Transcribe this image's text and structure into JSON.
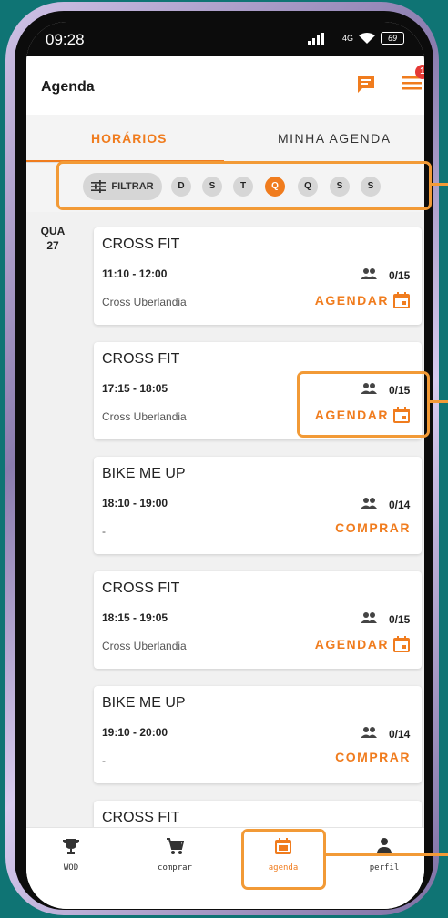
{
  "status": {
    "time": "09:28",
    "network": "4G",
    "battery": "69"
  },
  "header": {
    "title": "Agenda",
    "notification_count": "1"
  },
  "tabs": [
    {
      "label": "HORÁRIOS",
      "active": true
    },
    {
      "label": "MINHA AGENDA",
      "active": false
    }
  ],
  "filter": {
    "label": "FILTRAR",
    "days": [
      "D",
      "S",
      "T",
      "Q",
      "Q",
      "S",
      "S"
    ],
    "active_day_index": 3
  },
  "date": {
    "weekday": "QUA",
    "day": "27"
  },
  "classes": [
    {
      "name": "CROSS FIT",
      "time": "11:10 - 12:00",
      "capacity": "0/15",
      "location": "Cross Uberlandia",
      "action": "AGENDAR"
    },
    {
      "name": "CROSS FIT",
      "time": "17:15 - 18:05",
      "capacity": "0/15",
      "location": "Cross Uberlandia",
      "action": "AGENDAR"
    },
    {
      "name": "BIKE ME UP",
      "time": "18:10 - 19:00",
      "capacity": "0/14",
      "location": "-",
      "action": "COMPRAR"
    },
    {
      "name": "CROSS FIT",
      "time": "18:15 - 19:05",
      "capacity": "0/15",
      "location": "Cross Uberlandia",
      "action": "AGENDAR"
    },
    {
      "name": "BIKE ME UP",
      "time": "19:10 - 20:00",
      "capacity": "0/14",
      "location": "-",
      "action": "COMPRAR"
    },
    {
      "name": "CROSS FIT"
    }
  ],
  "nav": [
    {
      "label": "WOD",
      "icon": "trophy-icon"
    },
    {
      "label": "comprar",
      "icon": "cart-icon"
    },
    {
      "label": "agenda",
      "icon": "calendar-icon",
      "active": true
    },
    {
      "label": "perfil",
      "icon": "person-icon"
    }
  ],
  "colors": {
    "accent": "#f07c1e",
    "highlight": "#f29a36",
    "background": "#0f7474",
    "badge": "#e53935"
  }
}
